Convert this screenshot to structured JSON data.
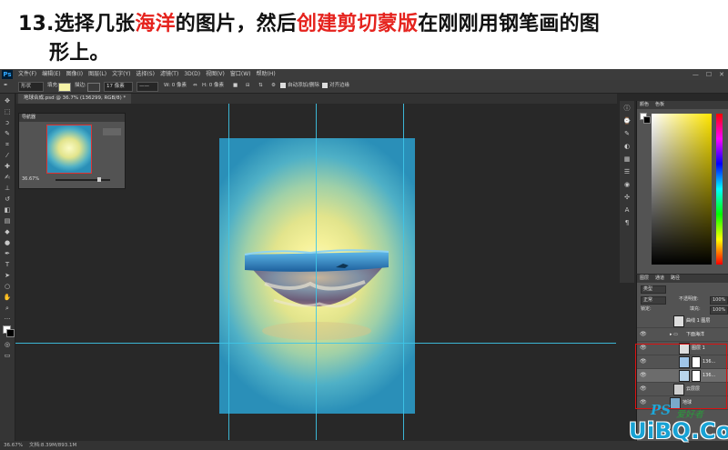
{
  "caption": {
    "step": "13.",
    "part1": "选择几张",
    "highlight1": "海洋",
    "part2": "的图片，然后",
    "highlight2": "创建剪切蒙版",
    "part3": "在刚刚用钢笔画的图",
    "line2": "形上。"
  },
  "menubar": {
    "logo": "Ps",
    "items": [
      "文件(F)",
      "编辑(E)",
      "图像(I)",
      "图层(L)",
      "文字(Y)",
      "选择(S)",
      "滤镜(T)",
      "3D(D)",
      "视图(V)",
      "窗口(W)",
      "帮助(H)"
    ],
    "controls": [
      "—",
      "☐",
      "✕"
    ]
  },
  "options_bar": {
    "mode": "形状",
    "fill_label": "填充:",
    "stroke_label": "描边:",
    "stroke_width": "17 像素",
    "w_label": "W: 0 像素",
    "h_label": "H: 0 像素",
    "auto_add": "自动添加/删除",
    "align_edges": "对齐边缘"
  },
  "document": {
    "tab_title": "地球合成.psd @ 36.7% (136299, RGB/8) *"
  },
  "navigator": {
    "tab": "导航器",
    "zoom": "36.67%"
  },
  "color_panel": {
    "tabs": [
      "颜色",
      "色板"
    ]
  },
  "layers_panel": {
    "tabs": [
      "图层",
      "通道",
      "路径"
    ],
    "filter": "类型",
    "blend_mode": "正常",
    "opacity_label": "不透明度:",
    "opacity": "100%",
    "lock_label": "锁定:",
    "fill_label": "填充:",
    "fill": "100%",
    "layers": [
      {
        "name": "曲线 1 图层",
        "eye": false
      },
      {
        "name": "下面海洋",
        "eye": true
      },
      {
        "name": "图层 1",
        "eye": true
      },
      {
        "name": "136...",
        "eye": true
      },
      {
        "name": "136...",
        "eye": true
      },
      {
        "name": "云层层",
        "eye": true
      },
      {
        "name": "地球",
        "eye": true
      }
    ]
  },
  "status": {
    "zoom": "36.67%",
    "doc": "文档:8.39M/893.1M"
  },
  "watermark": {
    "ps": "PS",
    "cn": "爱好者",
    "site": "UiBQ.CoM"
  },
  "colors": {
    "accent_red": "#e5231e",
    "guide": "#3ec5e8",
    "watermark_blue": "#18a2d4"
  }
}
